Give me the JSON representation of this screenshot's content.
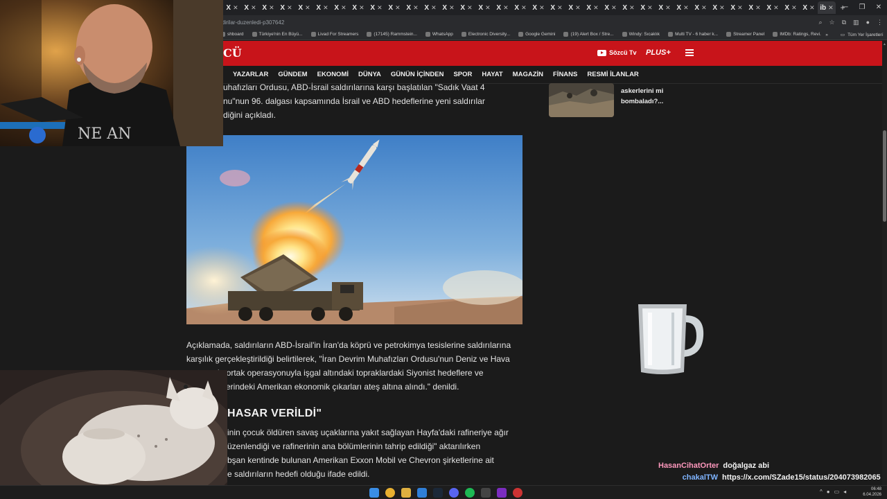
{
  "browser": {
    "tabs": [
      {
        "label": "X"
      },
      {
        "label": "X"
      },
      {
        "label": "X"
      },
      {
        "label": "X"
      },
      {
        "label": "X"
      },
      {
        "label": "X"
      },
      {
        "label": "X"
      },
      {
        "label": "X"
      },
      {
        "label": "X"
      },
      {
        "label": "X"
      },
      {
        "label": "X"
      },
      {
        "label": "X"
      },
      {
        "label": "X"
      },
      {
        "label": "X"
      },
      {
        "label": "X"
      },
      {
        "label": "X"
      },
      {
        "label": "X"
      },
      {
        "label": "X"
      },
      {
        "label": "X"
      },
      {
        "label": "X"
      },
      {
        "label": "X"
      },
      {
        "label": "X"
      },
      {
        "label": "X"
      },
      {
        "label": "X"
      },
      {
        "label": "X"
      },
      {
        "label": "X"
      },
      {
        "label": "X"
      },
      {
        "label": "X"
      },
      {
        "label": "X"
      },
      {
        "label": "X"
      },
      {
        "label": "X"
      },
      {
        "label": "X"
      },
      {
        "label": "X"
      }
    ],
    "active_tab_label": "ib",
    "url": "dirilar-duzenledi-p307642",
    "bookmarks": [
      "shboard",
      "Türkiye'nin En Büyü...",
      "Livad For Streamers",
      "(17145) Rammstein...",
      "WhatsApp",
      "Electronic Diversity...",
      "Google Gemini",
      "(19) Alert Box / Stre...",
      "Windy: Sıcaklık",
      "Multi TV - 6 haber k...",
      "Streamer Panel",
      "IMDb: Ratings, Revi...",
      "Ana Sayfa • HBO Max"
    ],
    "bookmarks_more": "»",
    "all_bookmarks": "Tüm Yer İşaretleri"
  },
  "site": {
    "logo": "CÜ",
    "tv_label": "Sözcü Tv",
    "plus_label": "PLUS+",
    "nav": [
      "YAZARLAR",
      "GÜNDEM",
      "EKONOMİ",
      "DÜNYA",
      "GÜNÜN İÇİNDEN",
      "SPOR",
      "HAYAT",
      "MAGAZİN",
      "FİNANS",
      "RESMİ İLANLAR"
    ]
  },
  "article": {
    "intro_lines": [
      "uhafızları Ordusu, ABD-İsrail saldırılarına karşı başlatılan \"Sadık Vaat 4",
      "nu\"nun 96. dalgası kapsamında İsrail ve ABD hedeflerine yeni saldırılar",
      "diğini açıkladı."
    ],
    "para2_lines": [
      "Açıklamada, saldırıların ABD-İsrail'in İran'da köprü ve petrokimya tesislerine saldırılarına",
      "karşılık gerçekleştirildiği belirtilerek, \"İran Devrim Muhafızları Ordusu'nun Deniz ve Hava",
      "in ortak operasyonuyla işgal altındaki topraklardaki Siyonist hedeflere ve",
      "erindeki Amerikan ekonomik çıkarları ateş altına alındı.\" denildi."
    ],
    "subheading": "HASAR VERİLDİ\"",
    "para3_lines": [
      "inin çocuk öldüren savaş uçaklarına yakıt sağlayan Hayfa'daki rafineriye ağır",
      "üzenlendiği ve rafinerinin ana bölümlerinin tahrip edildiği\" aktarılırken",
      "bşan kentinde bulunan Amerikan Exxon Mobil ve Chevron şirketlerine ait",
      "e saldırıların hedefi olduğu ifade edildi."
    ]
  },
  "sidebar": {
    "card_title": "askerlerini mi bombaladı?..."
  },
  "webcam": {
    "shirt_text": "NE AN"
  },
  "chat": [
    {
      "user": "HasanCihatOrter",
      "message": "doğalgaz abi"
    },
    {
      "user": "chakalTW",
      "message": "https://x.com/SZade15/status/2040739820650352655?s=20"
    }
  ],
  "taskbar": {
    "time": "06:48",
    "date": "6.04.2026"
  }
}
